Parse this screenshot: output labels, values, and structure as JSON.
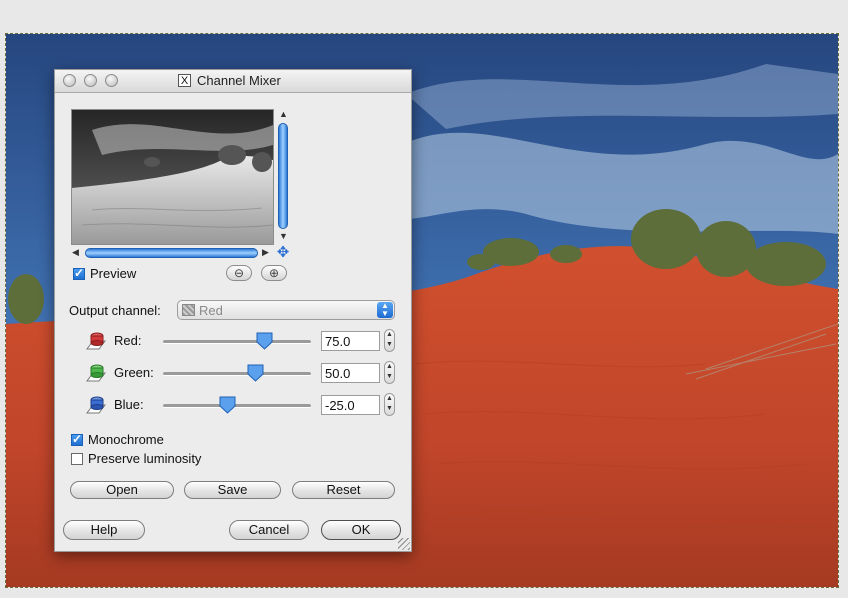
{
  "window": {
    "title": "Channel Mixer",
    "title_icon": "x11-icon",
    "controls": [
      "close",
      "minimize",
      "zoom"
    ]
  },
  "preview": {
    "label": "Preview",
    "checked": true,
    "zoom_out_icon": "zoom-out-icon",
    "zoom_in_icon": "zoom-in-icon",
    "navigate_icon": "move-icon"
  },
  "output_channel": {
    "label": "Output channel:",
    "value": "Red"
  },
  "channels": [
    {
      "label": "Red:",
      "value": "75.0",
      "level": 75,
      "icon": "red-channel-icon",
      "color": "#d23a3a"
    },
    {
      "label": "Green:",
      "value": "50.0",
      "level": 50,
      "icon": "green-channel-icon",
      "color": "#4cb84c"
    },
    {
      "label": "Blue:",
      "value": "-25.0",
      "level": -25,
      "icon": "blue-channel-icon",
      "color": "#3a6ed2"
    }
  ],
  "slider_range": [
    -200,
    200
  ],
  "monochrome": {
    "label": "Monochrome",
    "checked": true
  },
  "preserve_luminosity": {
    "label": "Preserve luminosity",
    "checked": false
  },
  "buttons": {
    "open": "Open",
    "save": "Save",
    "reset": "Reset",
    "help": "Help",
    "cancel": "Cancel",
    "ok": "OK"
  },
  "colors": {
    "accent": "#2d79d8",
    "sand": "#c8462a",
    "sky": "#3d6cae"
  }
}
